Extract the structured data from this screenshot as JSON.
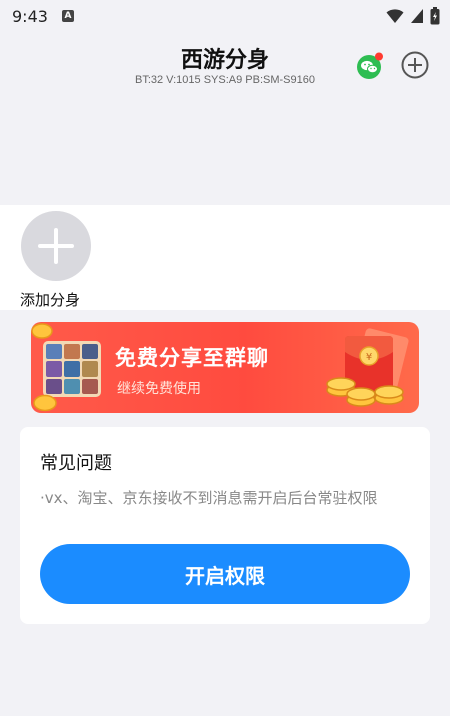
{
  "status_bar": {
    "time": "9:43",
    "a_badge": "A"
  },
  "header": {
    "title": "西游分身",
    "sub_info": "BT:32 V:1015 SYS:A9 PB:SM-S9160",
    "wechat_icon": "wechat-icon",
    "add_icon": "circle-plus-icon"
  },
  "clone": {
    "add_label": "添加分身"
  },
  "banner": {
    "title": "免费分享至群聊",
    "subtitle": "继续免费使用"
  },
  "faq": {
    "title": "常见问题",
    "text": "·vx、淘宝、京东接收不到消息需开启后台常驻权限",
    "button_label": "开启权限"
  },
  "colors": {
    "accent_blue": "#1b8cff",
    "banner_red": "#ff4b3f",
    "wechat_green": "#2ebd52",
    "notify_red": "#ff3b30"
  }
}
